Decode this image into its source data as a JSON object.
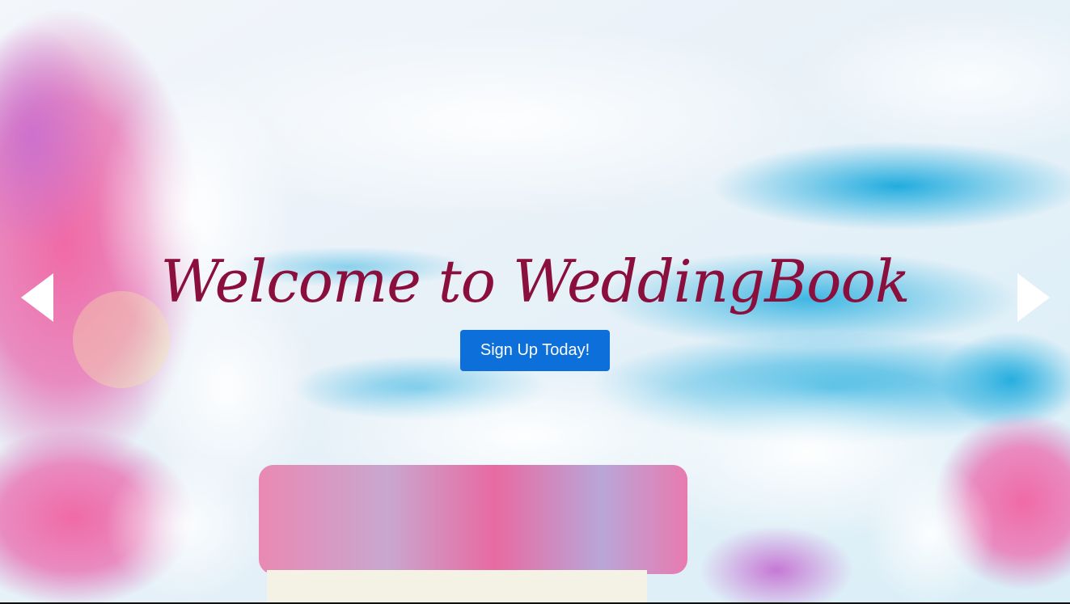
{
  "hero": {
    "title": "Welcome to WeddingBook",
    "cta_label": "Sign Up Today!",
    "background_description_icon": "wedding-flowers-sky-image"
  },
  "carousel": {
    "prev_icon": "triangle-left-icon",
    "next_icon": "triangle-right-icon"
  },
  "colors": {
    "title": "#8a0f3d",
    "button": "#0d6fd9",
    "button_text": "#ffffff",
    "arrow": "#ffffff"
  }
}
